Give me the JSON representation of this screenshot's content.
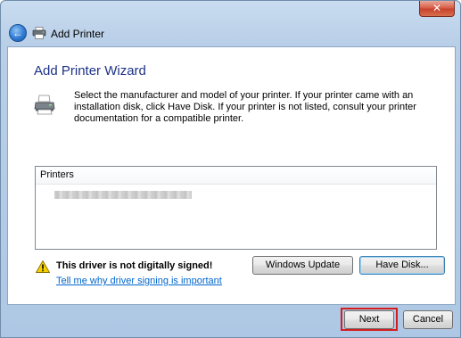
{
  "window": {
    "title": "Add Printer",
    "close_glyph": "✕",
    "back_glyph": "←"
  },
  "wizard": {
    "heading": "Add Printer Wizard",
    "description": "Select the manufacturer and model of your printer. If your printer came with an installation disk, click Have Disk. If your printer is not listed, consult your printer documentation for a compatible printer."
  },
  "printers_list": {
    "header": "Printers"
  },
  "warning": {
    "text": "This driver is not digitally signed!",
    "link": "Tell me why driver signing is important"
  },
  "buttons": {
    "windows_update": "Windows Update",
    "have_disk": "Have Disk...",
    "next": "Next",
    "cancel": "Cancel"
  },
  "icons": {
    "back": "back-arrow-icon",
    "title": "printer-icon",
    "wizard": "printer-icon",
    "warning": "warning-icon"
  },
  "colors": {
    "heading": "#1e3287",
    "link": "#0066cc",
    "highlight_frame": "#d21e1e"
  }
}
